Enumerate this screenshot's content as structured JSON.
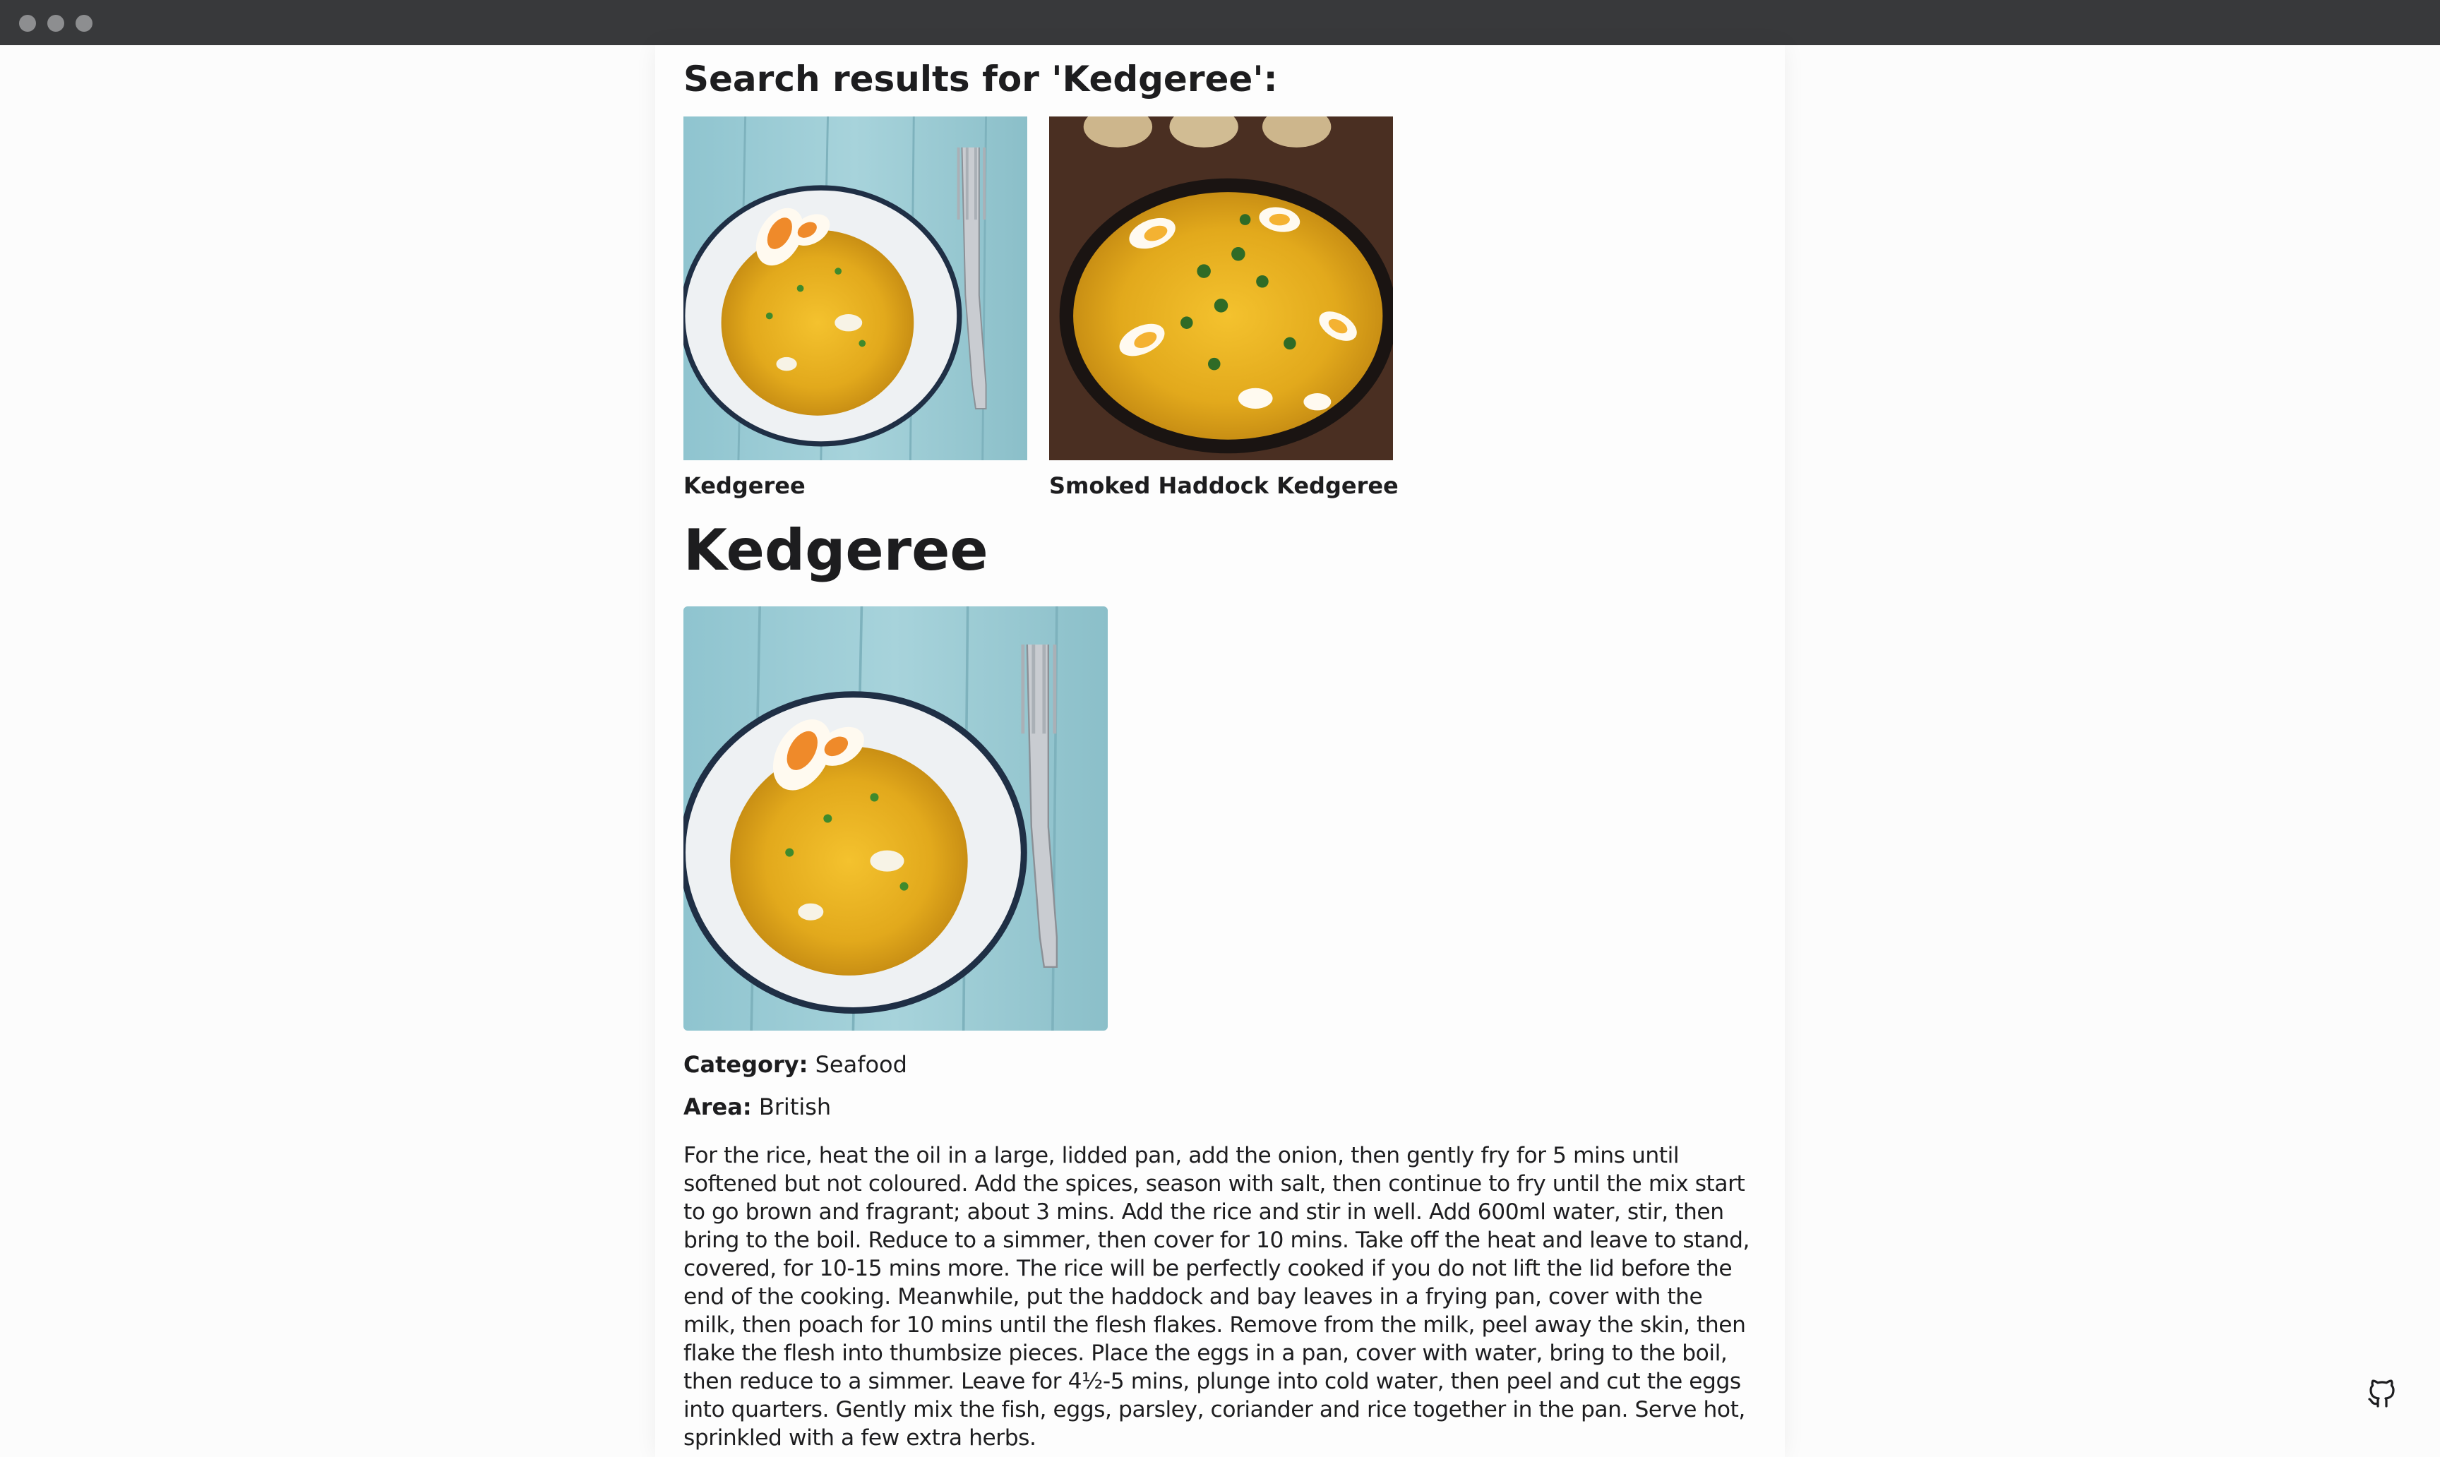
{
  "search": {
    "heading": "Search results for 'Kedgeree':",
    "results": [
      {
        "label": "Kedgeree"
      },
      {
        "label": "Smoked Haddock Kedgeree"
      }
    ]
  },
  "recipe": {
    "title": "Kedgeree",
    "category_label": "Category:",
    "category_value": "Seafood",
    "area_label": "Area:",
    "area_value": "British",
    "instructions": "For the rice, heat the oil in a large, lidded pan, add the onion, then gently fry for 5 mins until softened but not coloured. Add the spices, season with salt, then continue to fry until the mix start to go brown and fragrant; about 3 mins. Add the rice and stir in well. Add 600ml water, stir, then bring to the boil. Reduce to a simmer, then cover for 10 mins. Take off the heat and leave to stand, covered, for 10-15 mins more. The rice will be perfectly cooked if you do not lift the lid before the end of the cooking. Meanwhile, put the haddock and bay leaves in a frying pan, cover with the milk, then poach for 10 mins until the flesh flakes. Remove from the milk, peel away the skin, then flake the flesh into thumbsize pieces. Place the eggs in a pan, cover with water, bring to the boil, then reduce to a simmer. Leave for 4½-5 mins, plunge into cold water, then peel and cut the eggs into quarters. Gently mix the fish, eggs, parsley, coriander and rice together in the pan. Serve hot, sprinkled with a few extra herbs."
  },
  "icons": {
    "github": "github-icon"
  }
}
